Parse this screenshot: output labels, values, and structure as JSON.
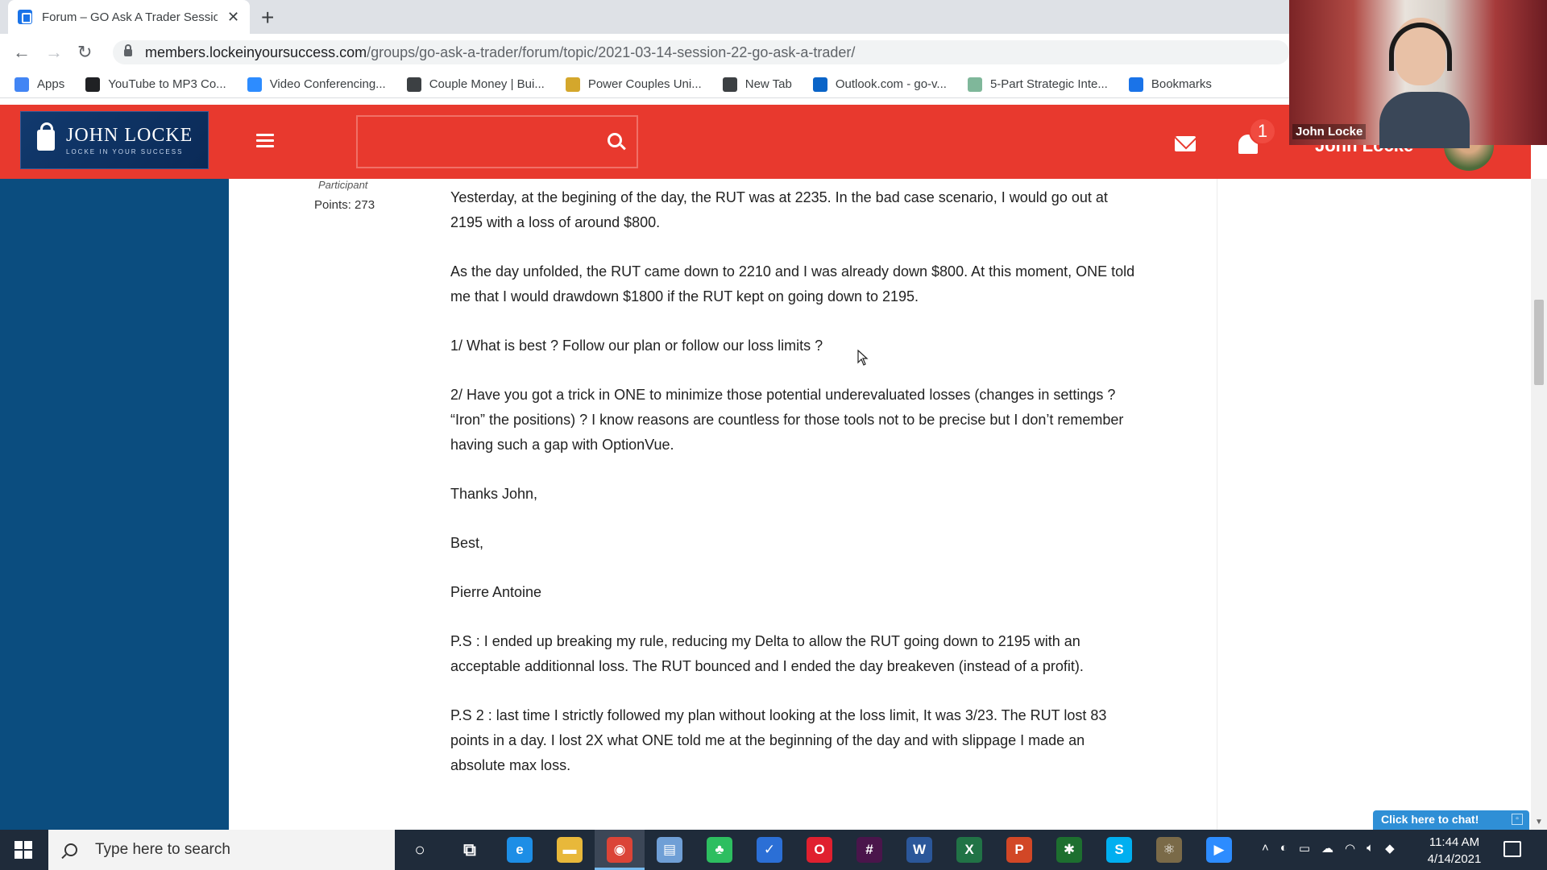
{
  "browser": {
    "tab_title": "Forum – GO Ask A Trader Session",
    "url_host": "members.lockeinyoursuccess.com",
    "url_path": "/groups/go-ask-a-trader/forum/topic/2021-03-14-session-22-go-ask-a-trader/",
    "bookmarks": [
      {
        "label": "Apps",
        "icon": "apps-grid-icon",
        "color": "#4285f4"
      },
      {
        "label": "YouTube to MP3 Co...",
        "icon": "music-note-icon",
        "color": "#202124"
      },
      {
        "label": "Video Conferencing...",
        "icon": "zoom-icon",
        "color": "#2d8cff"
      },
      {
        "label": "Couple Money | Bui...",
        "icon": "wordpress-icon",
        "color": "#3c4043"
      },
      {
        "label": "Power Couples Uni...",
        "icon": "folder-icon",
        "color": "#d4a72c"
      },
      {
        "label": "New Tab",
        "icon": "globe-icon",
        "color": "#3c4043"
      },
      {
        "label": "Outlook.com - go-v...",
        "icon": "outlook-icon",
        "color": "#0a64c8"
      },
      {
        "label": "5-Part Strategic Inte...",
        "icon": "circle-logo-icon",
        "color": "#7fb79a"
      },
      {
        "label": "Bookmarks",
        "icon": "star-icon",
        "color": "#1a73e8"
      }
    ],
    "more": "»"
  },
  "site": {
    "logo_text": "JOHN LOCKE",
    "logo_sub": "LOCKE IN YOUR SUCCESS",
    "notification_count": "1",
    "username": "John Locke",
    "accent": "#e8392e"
  },
  "webcam": {
    "name": "John Locke"
  },
  "author": {
    "role": "Participant",
    "points": "Points: 273"
  },
  "post": {
    "paragraphs": [
      "Yesterday, at the begining of the day, the RUT was at 2235. In the bad case scenario, I would go out at 2195 with a loss of around $800.",
      "As the day unfolded, the RUT came down to 2210 and I was already down $800. At this moment, ONE told me that I would drawdown $1800 if the RUT kept on going down to 2195.",
      "1/ What is best ? Follow our plan or follow our loss limits ?",
      "2/ Have you got a trick in ONE to minimize those potential underevaluated losses (changes in settings ? “Iron” the positions) ? I know reasons are countless for those tools not to be precise but I don’t remember having such a gap with OptionVue.",
      "Thanks John,",
      "Best,",
      "Pierre Antoine",
      "P.S : I ended up breaking my rule, reducing my Delta to allow the RUT going down to 2195 with an acceptable additionnal loss. The RUT bounced and I ended the day breakeven (instead of a profit).",
      "P.S 2 : last time I strictly followed my plan without looking at the loss limit, It was 3/23. The RUT lost 83 points in a day. I lost 2X what ONE told me at the beginning of the day and with slippage I made an absolute max loss."
    ]
  },
  "chat": {
    "label": "Click here to chat!"
  },
  "taskbar": {
    "search_placeholder": "Type here to search",
    "time": "11:44 AM",
    "date": "4/14/2021",
    "apps": [
      {
        "name": "cortana-icon",
        "glyph": "○",
        "color": "transparent"
      },
      {
        "name": "task-view-icon",
        "glyph": "⧉",
        "color": "transparent"
      },
      {
        "name": "edge-icon",
        "glyph": "e",
        "color": "#1d8ee6"
      },
      {
        "name": "file-explorer-icon",
        "glyph": "▬",
        "color": "#e8b83a"
      },
      {
        "name": "chrome-icon",
        "glyph": "◉",
        "color": "#db4437"
      },
      {
        "name": "notebook-icon",
        "glyph": "▤",
        "color": "#6f9fd6"
      },
      {
        "name": "evernote-icon",
        "glyph": "♣",
        "color": "#2dbe60"
      },
      {
        "name": "todo-icon",
        "glyph": "✓",
        "color": "#2b6fd6"
      },
      {
        "name": "opera-icon",
        "glyph": "O",
        "color": "#e0202f"
      },
      {
        "name": "slack-icon",
        "glyph": "#",
        "color": "#4a154b"
      },
      {
        "name": "word-icon",
        "glyph": "W",
        "color": "#2b579a"
      },
      {
        "name": "excel-icon",
        "glyph": "X",
        "color": "#217346"
      },
      {
        "name": "powerpoint-icon",
        "glyph": "P",
        "color": "#d24726"
      },
      {
        "name": "greenshot-icon",
        "glyph": "✱",
        "color": "#1d6f2f"
      },
      {
        "name": "skype-icon",
        "glyph": "S",
        "color": "#00aff0"
      },
      {
        "name": "atom-icon",
        "glyph": "⚛",
        "color": "#7a6a48"
      },
      {
        "name": "zoom-icon",
        "glyph": "▶",
        "color": "#2d8cff"
      }
    ]
  }
}
